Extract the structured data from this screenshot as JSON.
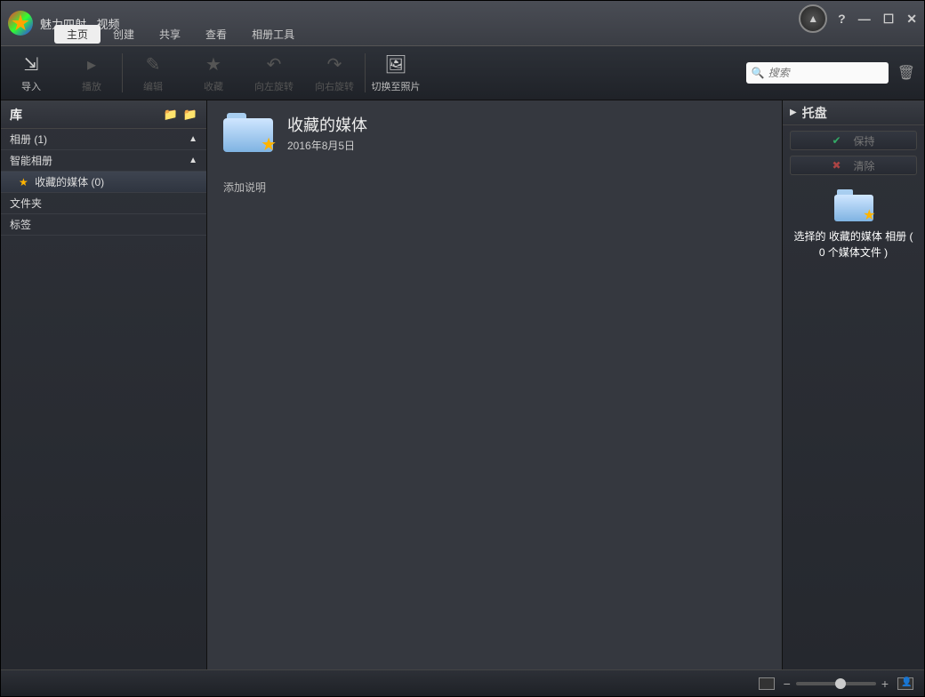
{
  "title": "魅力四射 - 视频",
  "menu": {
    "home": "主页",
    "create": "创建",
    "share": "共享",
    "view": "查看",
    "album_tools": "相册工具"
  },
  "toolbar": {
    "import": "导入",
    "play": "播放",
    "edit": "编辑",
    "favorite": "收藏",
    "rotate_left": "向左旋转",
    "rotate_right": "向右旋转",
    "switch_photo": "切换至照片"
  },
  "search": {
    "placeholder": "搜索"
  },
  "sidebar": {
    "title": "库",
    "albums": "相册 (1)",
    "smart_albums": "智能相册",
    "fav_media": "收藏的媒体 (0)",
    "folders": "文件夹",
    "tags": "标签"
  },
  "main": {
    "album_title": "收藏的媒体",
    "album_date": "2016年8月5日",
    "add_desc": "添加说明"
  },
  "tray": {
    "title": "托盘",
    "keep": "保持",
    "clear": "清除",
    "selection_line1": "选择的 收藏的媒体 相册 ( 0 个媒体文件 )"
  }
}
